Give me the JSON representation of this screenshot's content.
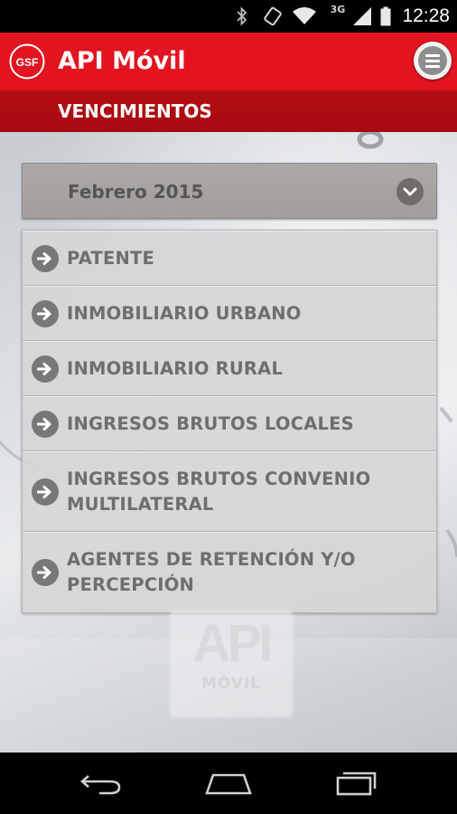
{
  "status_bar": {
    "network": "3G",
    "time": "12:28",
    "icons": [
      "bluetooth-icon",
      "screen-rotation-icon",
      "wifi-icon",
      "signal-icon",
      "battery-icon"
    ]
  },
  "app_bar": {
    "logo_text": "GSF",
    "title": "API Móvil",
    "color": "#e2141f",
    "menu_icon": "menu-icon"
  },
  "section": {
    "title": "VENCIMIENTOS",
    "color": "#a70a11"
  },
  "period_select": {
    "value": "Febrero 2015",
    "icon": "chevron-down-icon"
  },
  "menu": {
    "items": [
      {
        "label_lines": [
          "PATENTE"
        ]
      },
      {
        "label_lines": [
          "INMOBILIARIO URBANO"
        ]
      },
      {
        "label_lines": [
          "INMOBILIARIO RURAL"
        ]
      },
      {
        "label_lines": [
          "INGRESOS BRUTOS LOCALES"
        ]
      },
      {
        "label_lines": [
          "INGRESOS BRUTOS CONVENIO",
          "MULTILATERAL"
        ]
      },
      {
        "label_lines": [
          "AGENTES DE RETENCIÓN Y/O",
          "PERCEPCIÓN"
        ]
      }
    ],
    "item_icon": "arrow-right-icon"
  },
  "watermark": {
    "logo_text": "API",
    "sub_text": "MÓVIL"
  },
  "nav_bar": {
    "icons": [
      "back-icon",
      "home-icon",
      "recent-apps-icon"
    ]
  }
}
